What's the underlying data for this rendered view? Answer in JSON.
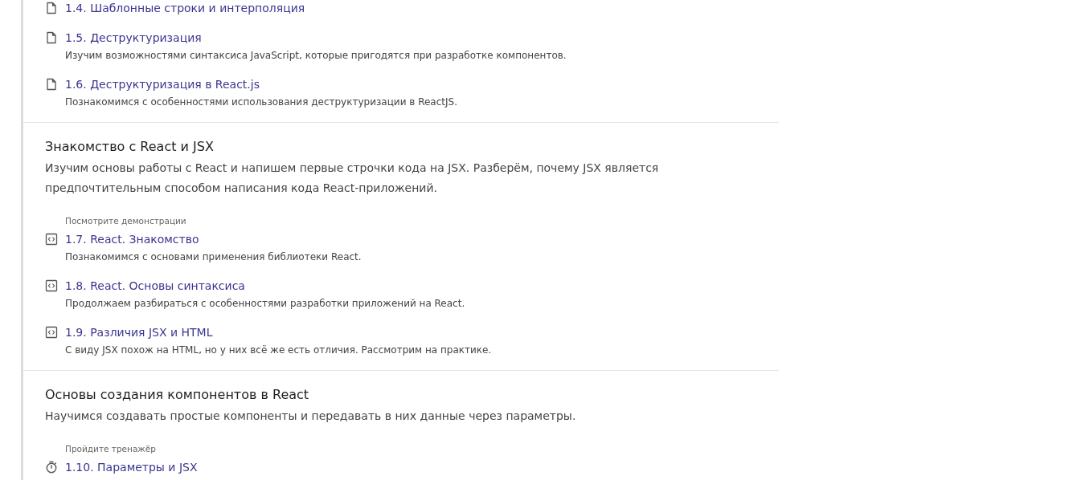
{
  "sections": [
    {
      "groups": [
        {
          "items": [
            {
              "kind": "doc",
              "title": "1.4. Шаблонные строки и интерполяция"
            },
            {
              "kind": "doc",
              "title": "1.5. Деструктуризация",
              "description": "Изучим возможностями синтаксиса JavaScript, которые пригодятся при разработке компонентов."
            },
            {
              "kind": "doc",
              "title": "1.6. Деструктуризация в React.js",
              "description": "Познакомимся с особенностями использования деструктуризации в ReactJS."
            }
          ]
        }
      ]
    },
    {
      "title": "Знакомство с React и JSX",
      "description": "Изучим основы работы с React и напишем первые строчки кода на JSX. Разберём, почему JSX является предпочтительным способом написания кода React-приложений.",
      "groups": [
        {
          "label": "Посмотрите демонстрации",
          "items": [
            {
              "kind": "code",
              "title": "1.7. React. Знакомство",
              "description": "Познакомимся с основами применения библиотеки React."
            },
            {
              "kind": "code",
              "title": "1.8. React. Основы синтаксиса",
              "description": "Продолжаем разбираться с особенностями разработки приложений на React."
            },
            {
              "kind": "code",
              "title": "1.9. Различия JSX и HTML",
              "description": "С виду JSX похож на HTML, но у них всё же есть отличия. Рассмотрим на практике."
            }
          ]
        }
      ]
    },
    {
      "title": "Основы создания компонентов в React",
      "description": "Научимся создавать простые компоненты и передавать в них данные через параметры.",
      "groups": [
        {
          "label": "Пройдите тренажёр",
          "items": [
            {
              "kind": "timer",
              "title": "1.10. Параметры и JSX"
            }
          ]
        }
      ]
    }
  ]
}
